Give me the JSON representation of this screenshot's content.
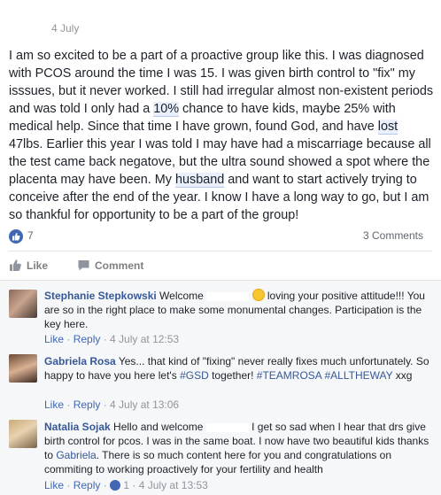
{
  "post": {
    "date": "4 July",
    "text_parts": {
      "p1": "I am so excited to be a part of a proactive group like this. I was diagnosed with PCOS around the time I was 15. I was given birth control to \"fix\" my isssues, but it never worked. I still had irregular almost non-existent periods and was told I only had a ",
      "h1": "10%",
      "p2": " chance to have kids, maybe 25% with medical help. Since that time I have grown, found God, and have ",
      "h2": "lost",
      "p3": " 47lbs. Earlier this year I was told I may have had a miscarriage because all the test came back negatove, but the ultra sound showed a spot where the placenta may have been. My ",
      "h3": "husband",
      "p4": " and want to start actively trying to conceive after the end of the year. I know I have a long way to go, but I am so thankful for opportunity to be a part of the group!"
    },
    "like_count": "7",
    "comments_count": "3 Comments",
    "actions": {
      "like": "Like",
      "comment": "Comment"
    }
  },
  "comments": [
    {
      "author": "Stephanie Stepkowski",
      "text_a": " Welcome ",
      "text_b": " loving your positive attitude!!! You are so in the right place to make some monumental changes. Participation is the key here.",
      "like": "Like",
      "reply": "Reply",
      "time": "4 July at 12:53"
    },
    {
      "author": "Gabriela Rosa",
      "text_a": " Yes... that kind of \"fixing\" never really fixes much unfortunately. So happy to have you here let's ",
      "tag1": "#GSD",
      "text_b": " together! ",
      "tag2": "#TEAMROSA",
      "tag3": "#ALLTHEWAY",
      "text_c": " xxg",
      "like": "Like",
      "reply": "Reply",
      "time": "4 July at 13:06"
    },
    {
      "author": "Natalia Sojak",
      "text_a": " Hello and welcome ",
      "text_b": " I get so sad when I hear that drs give birth control for pcos. I was in the same boat. I now have two beautiful kids thanks to ",
      "mention": "Gabriela",
      "text_c": ". There is so much content here for you and congratulations on commiting to working proactively for your fertility and health",
      "like": "Like",
      "reply": "Reply",
      "like_count": "1",
      "time": "4 July at 13:53"
    }
  ],
  "colors": {
    "link_blue": "#365899",
    "like_blue": "#4267b2",
    "meta_gray": "#90949c",
    "comment_bg": "#f6f7f9"
  }
}
